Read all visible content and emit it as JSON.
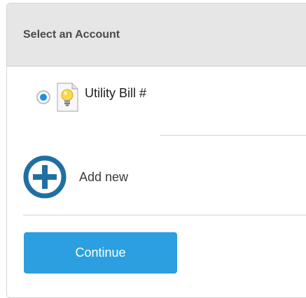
{
  "panel": {
    "title": "Select an Account"
  },
  "accounts": [
    {
      "label": "Utility Bill #",
      "selected": true,
      "icon": "lightbulb-document-icon"
    }
  ],
  "add_new": {
    "label": "Add new",
    "icon": "plus-circle-icon"
  },
  "actions": {
    "continue_label": "Continue"
  },
  "colors": {
    "accent": "#2b9fe0",
    "radio_selected": "#1f8fe0",
    "add_icon": "#1f6fa3",
    "header_bg": "#e6e6e6"
  }
}
